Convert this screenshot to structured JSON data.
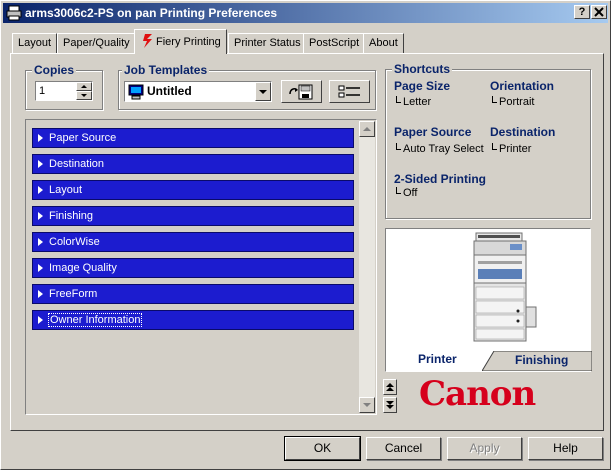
{
  "window": {
    "title": "arms3006c2-PS on pan Printing Preferences",
    "help_btn": "?",
    "close_btn": "X"
  },
  "tabs": [
    {
      "label": "Layout",
      "active": false
    },
    {
      "label": "Paper/Quality",
      "active": false
    },
    {
      "label": "Fiery Printing",
      "active": true
    },
    {
      "label": "Printer Status",
      "active": false
    },
    {
      "label": "PostScript",
      "active": false
    },
    {
      "label": "About",
      "active": false
    }
  ],
  "copies": {
    "label": "Copies",
    "value": "1"
  },
  "job_templates": {
    "label": "Job Templates",
    "selected": "Untitled"
  },
  "sections": [
    {
      "label": "Paper Source"
    },
    {
      "label": "Destination"
    },
    {
      "label": "Layout"
    },
    {
      "label": "Finishing"
    },
    {
      "label": "ColorWise"
    },
    {
      "label": "Image Quality"
    },
    {
      "label": "FreeForm"
    },
    {
      "label": "Owner Information"
    }
  ],
  "shortcuts": {
    "label": "Shortcuts",
    "page_size": {
      "label": "Page Size",
      "value": "Letter"
    },
    "orientation": {
      "label": "Orientation",
      "value": "Portrait"
    },
    "paper_source": {
      "label": "Paper Source",
      "value": "Auto Tray Select"
    },
    "destination": {
      "label": "Destination",
      "value": "Printer"
    },
    "two_sided": {
      "label": "2-Sided Printing",
      "value": "Off"
    }
  },
  "preview": {
    "tab_printer": "Printer",
    "tab_finishing": "Finishing"
  },
  "brand": {
    "logo_text": "Canon",
    "color": "#d6001c"
  },
  "buttons": {
    "ok": "OK",
    "cancel": "Cancel",
    "apply": "Apply",
    "help": "Help"
  },
  "colors": {
    "title_start": "#0a246a",
    "title_end": "#a6caf0",
    "section_blue": "#1c1ccf",
    "header_blue": "#0a246a"
  }
}
